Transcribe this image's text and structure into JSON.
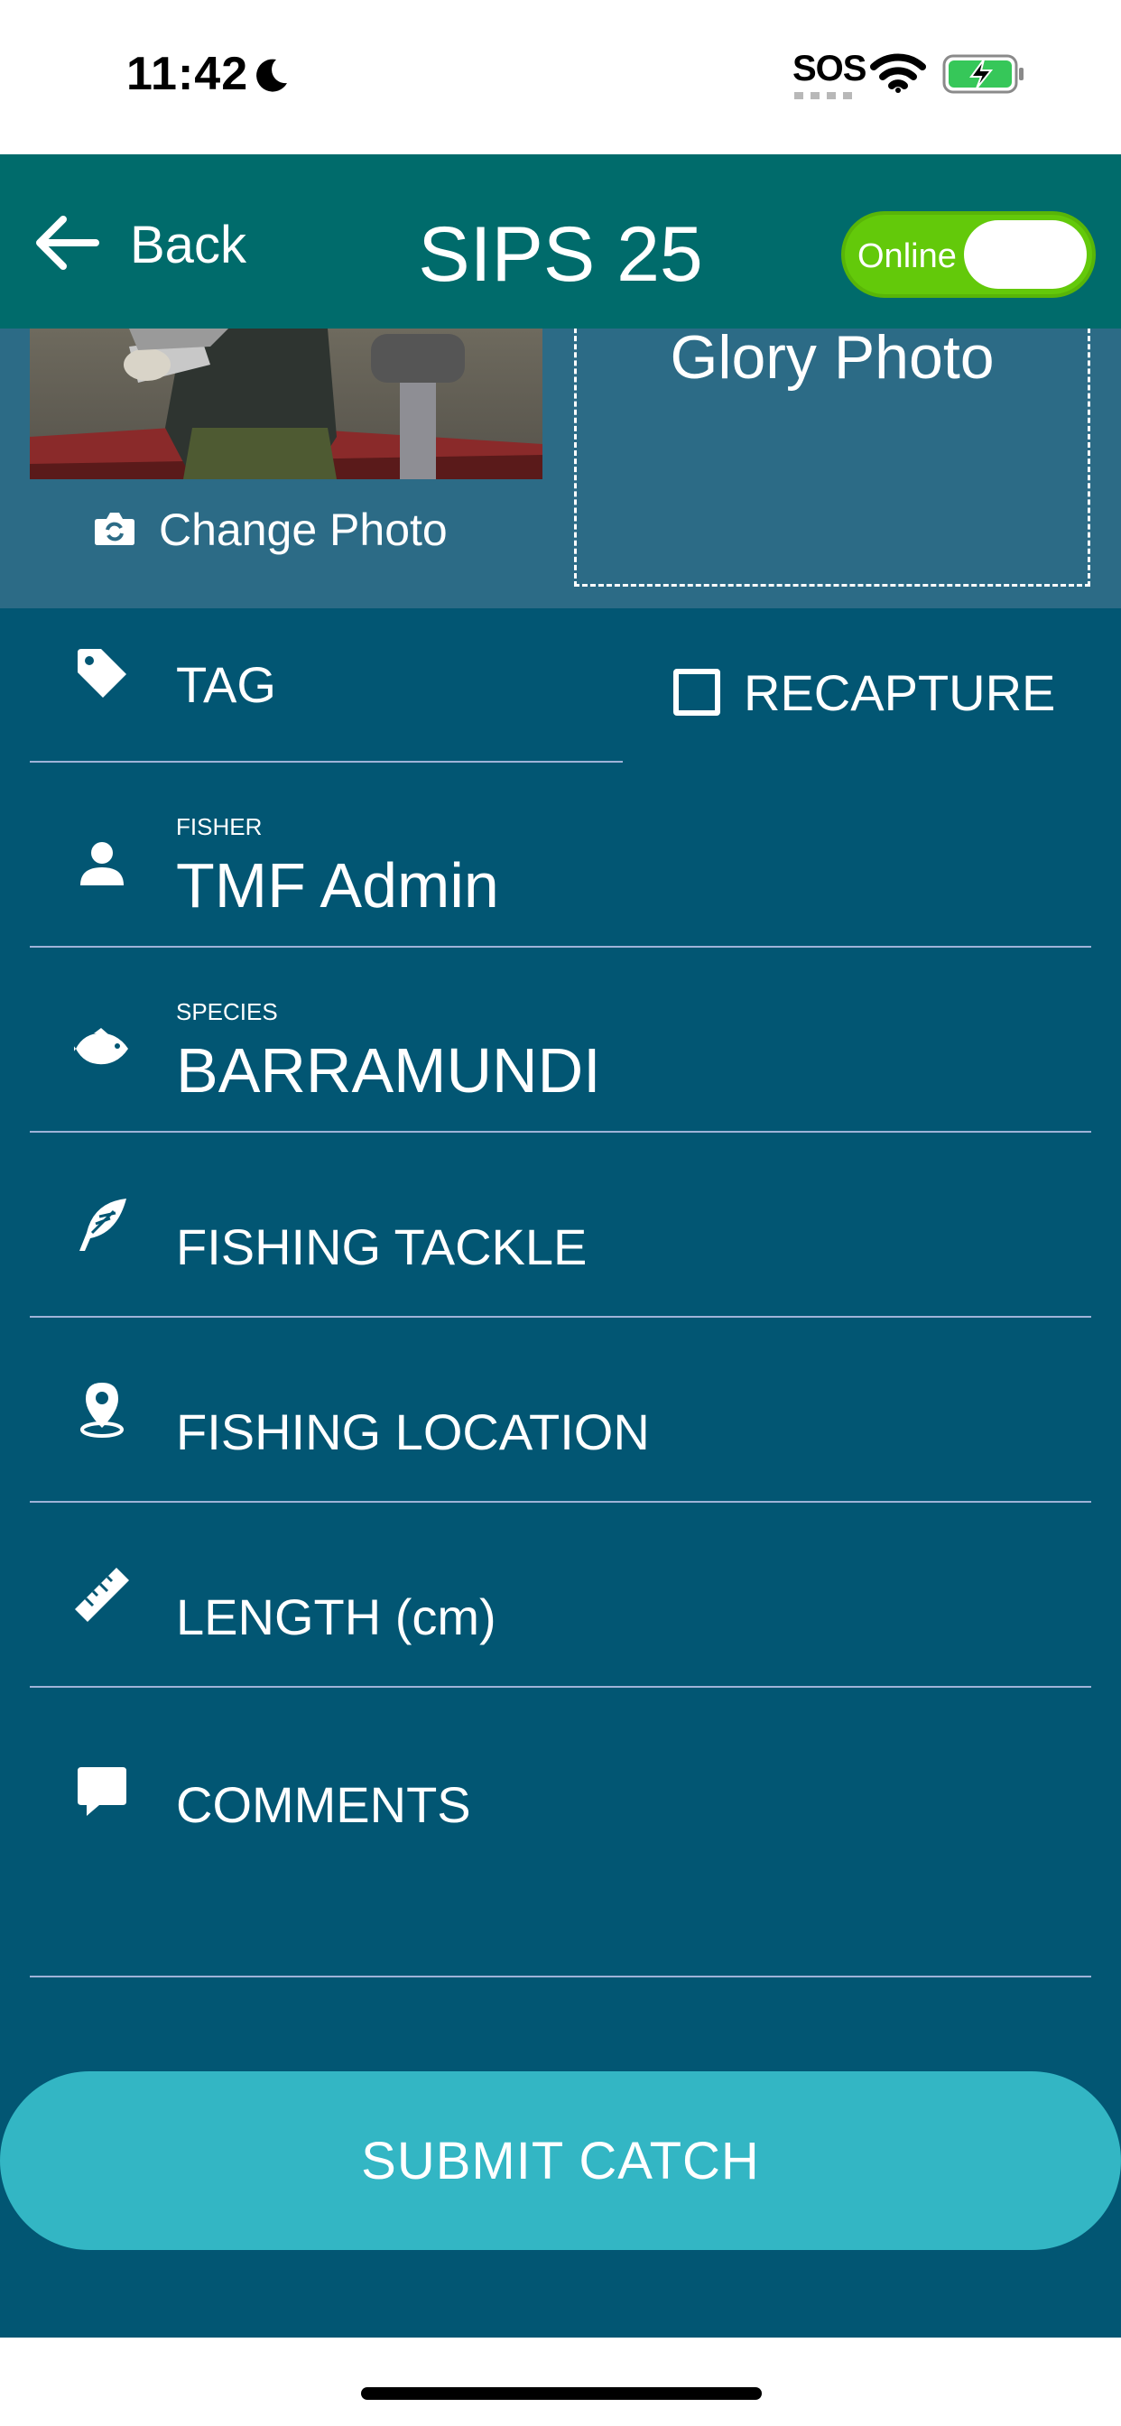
{
  "status_bar": {
    "time": "11:42",
    "sos": "SOS"
  },
  "header": {
    "back_label": "Back",
    "title": "SIPS 25",
    "online_label": "Online",
    "online_on": true
  },
  "photo": {
    "change_photo_label": "Change Photo",
    "glory_photo_label": "Glory Photo"
  },
  "form": {
    "tag": {
      "placeholder": "TAG"
    },
    "recapture": {
      "label": "RECAPTURE",
      "checked": false
    },
    "fisher": {
      "label": "FISHER",
      "value": "TMF Admin"
    },
    "species": {
      "label": "SPECIES",
      "value": "BARRAMUNDI"
    },
    "fishing_tackle": {
      "placeholder": "FISHING TACKLE"
    },
    "fishing_location": {
      "placeholder": "FISHING LOCATION"
    },
    "length": {
      "placeholder": "LENGTH (cm)"
    },
    "comments": {
      "placeholder": "COMMENTS"
    }
  },
  "submit_label": "SUBMIT CATCH",
  "colors": {
    "header": "#006b6b",
    "main_bg": "#025673",
    "photo_bg": "#2c6b86",
    "toggle_on": "#63c90a",
    "submit": "#33b6c4"
  },
  "icons": [
    "moon-icon",
    "wifi-icon",
    "battery-charging-icon",
    "back-arrow-icon",
    "camera-icon",
    "tag-icon",
    "person-icon",
    "fish-icon",
    "feather-icon",
    "location-pin-icon",
    "ruler-icon",
    "comment-icon",
    "checkbox-icon"
  ]
}
